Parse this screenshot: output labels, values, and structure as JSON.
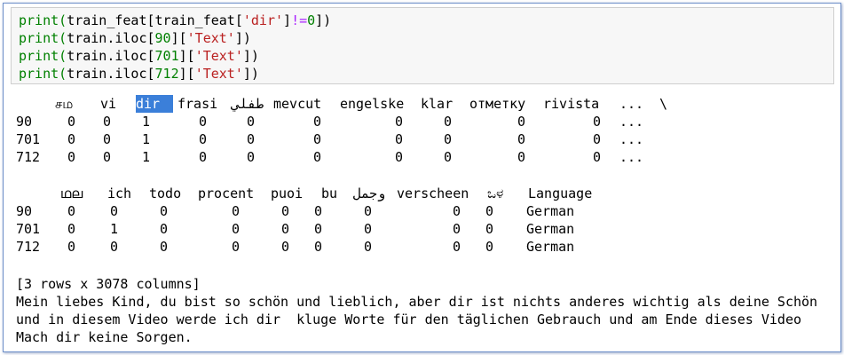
{
  "code": {
    "lines": [
      [
        "print(",
        "train_feat[train_feat[",
        "'dir'",
        "]",
        "!=",
        "0",
        "])"
      ],
      [
        "print(",
        "train.iloc[",
        "90",
        "][",
        "'Text'",
        "])"
      ],
      [
        "print(",
        "train.iloc[",
        "701",
        "][",
        "'Text'",
        "])"
      ],
      [
        "print(",
        "train.iloc[",
        "712",
        "][",
        "'Text'",
        "])"
      ]
    ]
  },
  "table1": {
    "header": [
      "சம",
      "vi",
      "dir",
      "frasi",
      "طفلي",
      "mevcut",
      "engelske",
      "klar",
      "отметку",
      "rivista",
      "...",
      "\\"
    ],
    "rows": [
      {
        "index": "90",
        "values": [
          "0",
          "0",
          "1",
          "0",
          "0",
          "0",
          "0",
          "0",
          "0",
          "0",
          "..."
        ]
      },
      {
        "index": "701",
        "values": [
          "0",
          "0",
          "1",
          "0",
          "0",
          "0",
          "0",
          "0",
          "0",
          "0",
          "..."
        ]
      },
      {
        "index": "712",
        "values": [
          "0",
          "0",
          "1",
          "0",
          "0",
          "0",
          "0",
          "0",
          "0",
          "0",
          "..."
        ]
      }
    ]
  },
  "table2": {
    "header": [
      "ഥല",
      "ich",
      "todo",
      "procent",
      "puoi",
      "bu",
      "وجمل",
      "verscheen",
      "ಒಳ",
      "Language"
    ],
    "rows": [
      {
        "index": "90",
        "values": [
          "0",
          "0",
          "0",
          "0",
          "0",
          "0",
          "0",
          "0",
          "0",
          "German"
        ]
      },
      {
        "index": "701",
        "values": [
          "0",
          "1",
          "0",
          "0",
          "0",
          "0",
          "0",
          "0",
          "0",
          "German"
        ]
      },
      {
        "index": "712",
        "values": [
          "0",
          "0",
          "0",
          "0",
          "0",
          "0",
          "0",
          "0",
          "0",
          "German"
        ]
      }
    ]
  },
  "summary": "[3 rows x 3078 columns]",
  "text_lines": [
    "Mein liebes Kind, du bist so schön und lieblich, aber dir ist nichts anderes wichtig als deine Schön",
    "und in diesem Video werde ich dir  kluge Worte für den täglichen Gebrauch und am Ende dieses Video",
    "Mach dir keine Sorgen."
  ]
}
